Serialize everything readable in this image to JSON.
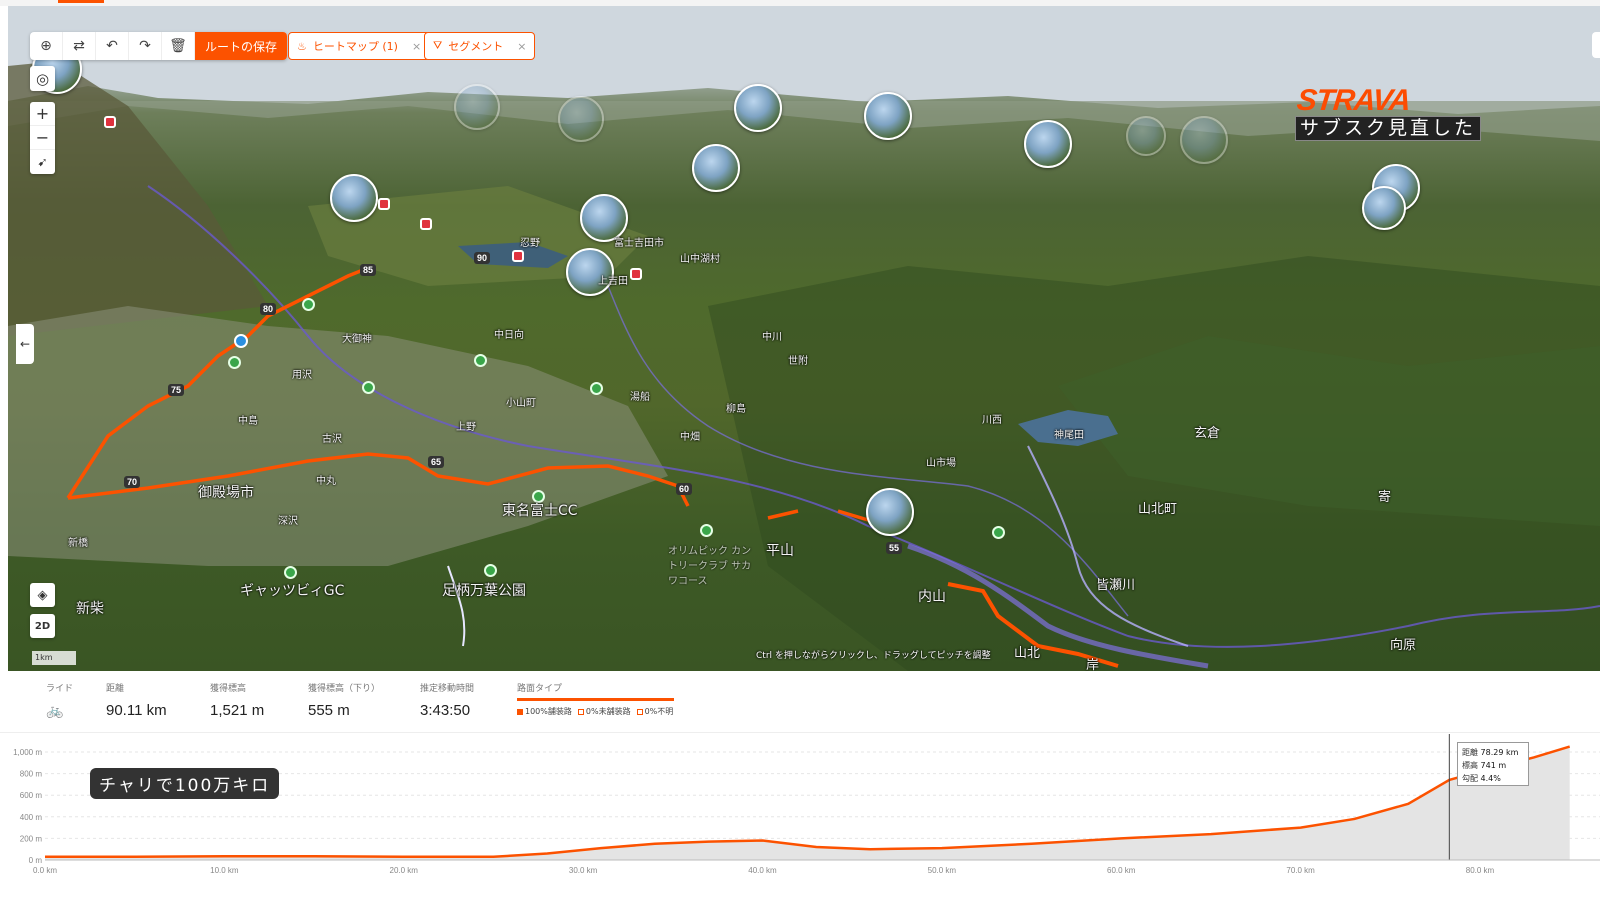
{
  "toolbar": {
    "save_route": "ルートの保存",
    "heatmap_chip": "ヒートマップ (1)",
    "segment_chip": "セグメント",
    "chip_close": "×"
  },
  "map": {
    "pitch_tip": "Ctrl を押しながらクリックし、ドラッグしてピッチを調整",
    "scale": "1km",
    "toggle_2d": "2D",
    "labels": [
      "御殿場市",
      "東名富士CC",
      "ギャッツビィGC",
      "足柄万葉公園",
      "新柴",
      "平山",
      "内山",
      "山北町",
      "皆瀬川",
      "向原",
      "山北",
      "岸",
      "玄倉",
      "寄",
      "神尾田",
      "川西",
      "山市場",
      "中川",
      "世附",
      "小山町",
      "中日向",
      "大御神",
      "湯船",
      "柳島",
      "上野",
      "古沢",
      "中丸",
      "深沢",
      "新橋",
      "中畑",
      "用沢",
      "中島",
      "富士吉田市",
      "山中湖村",
      "忍野",
      "上吉田",
      "オリムピック カントリークラブ サカワコース"
    ],
    "km_markers": [
      "85",
      "80",
      "75",
      "70",
      "65",
      "60",
      "55",
      "90"
    ]
  },
  "overlay": {
    "strava_logo": "STRAVA",
    "strava_caption": "サブスク見直した",
    "channel_caption": "チャリで100万キロ"
  },
  "stats": {
    "ride_label": "ライド",
    "distance_label": "距離",
    "distance": "90.11 km",
    "elev_gain_label": "獲得標高",
    "elev_gain": "1,521 m",
    "elev_loss_label": "獲得標高（下り）",
    "elev_loss": "555 m",
    "moving_time_label": "推定移動時間",
    "moving_time": "3:43:50",
    "surface_label": "路面タイプ",
    "surface_paved": "100%舗装路",
    "surface_unpaved": "0%未舗装路",
    "surface_unknown": "0%不明"
  },
  "colors": {
    "accent": "#fc5200",
    "route": "#fc5200",
    "ridge": "#6a5acd"
  },
  "chart_data": {
    "type": "area",
    "title": "",
    "xlabel": "",
    "ylabel": "",
    "xlim": [
      0,
      85
    ],
    "ylim": [
      0,
      1000
    ],
    "y_ticks": [
      "0 m",
      "200 m",
      "400 m",
      "600 m",
      "800 m",
      "1,000 m"
    ],
    "x_ticks": [
      "0.0 km",
      "10.0 km",
      "20.0 km",
      "30.0 km",
      "40.0 km",
      "50.0 km",
      "60.0 km",
      "70.0 km",
      "80.0 km"
    ],
    "x": [
      0,
      5,
      10,
      15,
      20,
      25,
      28,
      31,
      34,
      37,
      40,
      43,
      46,
      50,
      55,
      60,
      65,
      70,
      73,
      76,
      78.29,
      80,
      83,
      85
    ],
    "y": [
      30,
      30,
      35,
      35,
      30,
      30,
      60,
      110,
      150,
      170,
      180,
      120,
      100,
      110,
      150,
      200,
      240,
      300,
      380,
      520,
      741,
      820,
      950,
      1050
    ],
    "cursor": {
      "distance_label": "距離",
      "distance": "78.29 km",
      "elevation_label": "標高",
      "elevation": "741 m",
      "grade_label": "勾配",
      "grade": "4.4%"
    }
  }
}
